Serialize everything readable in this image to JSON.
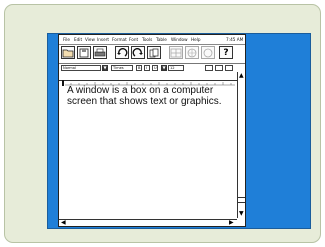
{
  "menubar": {
    "items": [
      "File",
      "Edit",
      "View",
      "Insert",
      "Format",
      "Font",
      "Tools",
      "Table",
      "Window",
      "Help"
    ],
    "clock": "7:45 AM"
  },
  "toolbar": {
    "buttons": [
      "folder-icon",
      "save-icon",
      "print-icon",
      "undo-icon",
      "redo-icon",
      "copy-icon",
      "table-icon",
      "globe-icon",
      "draw-icon",
      "help-icon"
    ],
    "help_label": "?"
  },
  "format_bar": {
    "style_value": "Normal",
    "font_value": "Times",
    "bold_label": "B",
    "italic_label": "I",
    "underline_label": "U",
    "size_value": "12"
  },
  "document": {
    "text": "A window is a box on a computer screen that shows text or graphics."
  },
  "colors": {
    "desktop": "#1f7fd8",
    "frame": "#e7ecd9",
    "window": "#ffffff"
  }
}
